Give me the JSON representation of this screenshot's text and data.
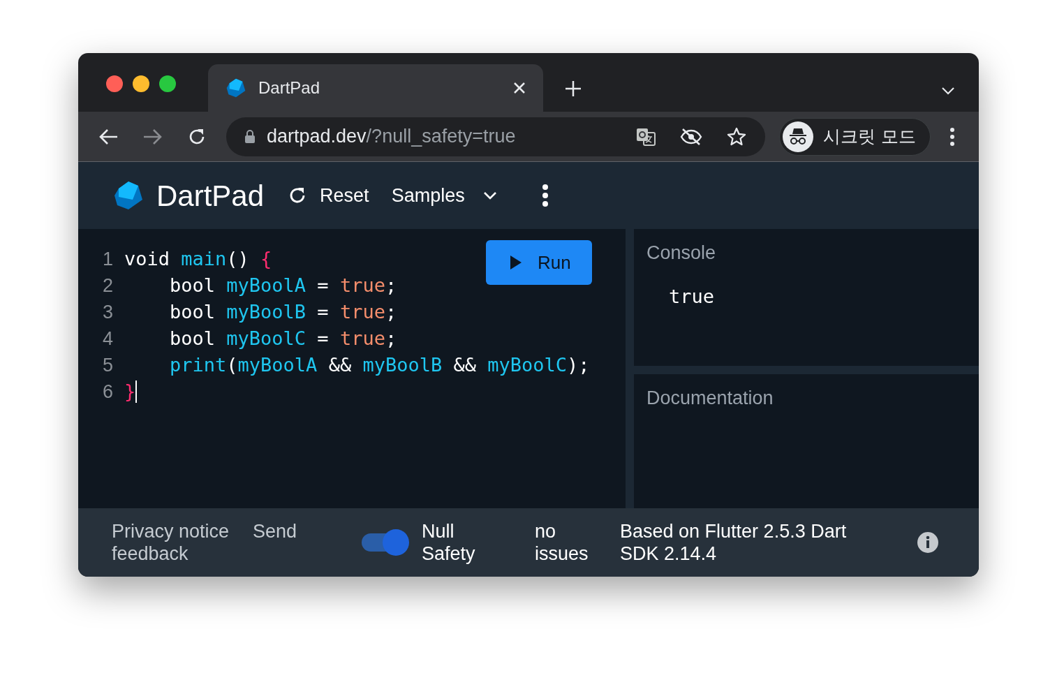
{
  "browser": {
    "tab": {
      "title": "DartPad",
      "selected": true
    },
    "address": {
      "host": "dartpad.dev",
      "path": "/?null_safety=true"
    },
    "profile": {
      "label": "시크릿 모드"
    }
  },
  "toolbar": {
    "title": "DartPad",
    "reset": "Reset",
    "samples": "Samples"
  },
  "editor": {
    "run": "Run",
    "lines": [
      {
        "number": "1",
        "tokens": [
          {
            "t": "void ",
            "kind": "plain"
          },
          {
            "t": "main",
            "kind": "ident"
          },
          {
            "t": "() ",
            "kind": "plain"
          },
          {
            "t": "{",
            "kind": "brace"
          }
        ]
      },
      {
        "number": "2",
        "tokens": [
          {
            "t": "    bool ",
            "kind": "plain"
          },
          {
            "t": "myBoolA",
            "kind": "ident"
          },
          {
            "t": " = ",
            "kind": "plain"
          },
          {
            "t": "true",
            "kind": "literal"
          },
          {
            "t": ";",
            "kind": "plain"
          }
        ]
      },
      {
        "number": "3",
        "tokens": [
          {
            "t": "    bool ",
            "kind": "plain"
          },
          {
            "t": "myBoolB",
            "kind": "ident"
          },
          {
            "t": " = ",
            "kind": "plain"
          },
          {
            "t": "true",
            "kind": "literal"
          },
          {
            "t": ";",
            "kind": "plain"
          }
        ]
      },
      {
        "number": "4",
        "tokens": [
          {
            "t": "    bool ",
            "kind": "plain"
          },
          {
            "t": "myBoolC",
            "kind": "ident"
          },
          {
            "t": " = ",
            "kind": "plain"
          },
          {
            "t": "true",
            "kind": "literal"
          },
          {
            "t": ";",
            "kind": "plain"
          }
        ]
      },
      {
        "number": "5",
        "tokens": [
          {
            "t": "    print",
            "kind": "ident"
          },
          {
            "t": "(",
            "kind": "plain"
          },
          {
            "t": "myBoolA",
            "kind": "ident"
          },
          {
            "t": " && ",
            "kind": "plain"
          },
          {
            "t": "myBoolB",
            "kind": "ident"
          },
          {
            "t": " && ",
            "kind": "plain"
          },
          {
            "t": "myBoolC",
            "kind": "ident"
          },
          {
            "t": ");",
            "kind": "plain"
          }
        ]
      },
      {
        "number": "6",
        "tokens": [
          {
            "t": "}",
            "kind": "brace"
          }
        ]
      }
    ]
  },
  "console": {
    "title": "Console",
    "output": "true"
  },
  "documentation": {
    "title": "Documentation"
  },
  "footer": {
    "privacy": "Privacy notice",
    "feedback": "Send feedback",
    "null_safety": {
      "label": "Null Safety",
      "on": true
    },
    "issues": "no issues",
    "version": "Based on Flutter 2.5.3 Dart SDK 2.14.4"
  }
}
